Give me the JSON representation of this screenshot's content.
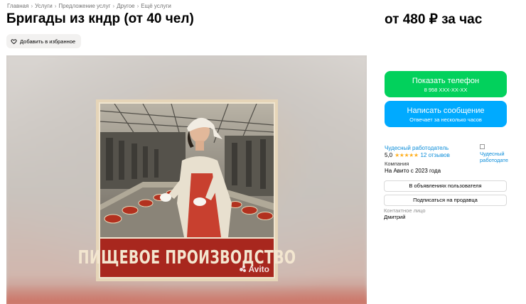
{
  "breadcrumbs": [
    "Главная",
    "Услуги",
    "Предложение услуг",
    "Другое",
    "Ещё услуги"
  ],
  "breadcrumb_separator": "›",
  "listing": {
    "title": "Бригады из кндр (от 40 чел)",
    "price": "от 480 ₽ за час"
  },
  "favorite": {
    "label": "Добавить в избранное",
    "icon": "heart-outline-icon"
  },
  "gallery": {
    "poster_caption": "ПИЩЕВОЕ ПРОИЗВОДСТВО",
    "watermark": "Avito",
    "colors": {
      "banner": "#a8271e",
      "poster_bg": "#efe4cf",
      "apron": "#c8402f"
    }
  },
  "actions": {
    "phone_label": "Показать телефон",
    "phone_masked": "8 958 XXX-XX-XX",
    "message_label": "Написать сообщение",
    "message_sub": "Отвечает за несколько часов"
  },
  "seller": {
    "name": "Чудесный работодатель",
    "rating": "5,0",
    "stars": "★★★★★",
    "reviews": "12 отзывов",
    "type": "Компания",
    "since": "На Авито с 2023 года",
    "avatar_alt": "Чудесный работодатель"
  },
  "seller_buttons": {
    "listings": "В объявлениях пользователя",
    "subscribe": "Подписаться на продавца"
  },
  "contact": {
    "label": "Контактное лицо",
    "name": "Дмитрий"
  },
  "theme": {
    "green": "#02d15c",
    "blue": "#00aaff",
    "link": "#0a8cd9",
    "star": "#ffb021"
  }
}
